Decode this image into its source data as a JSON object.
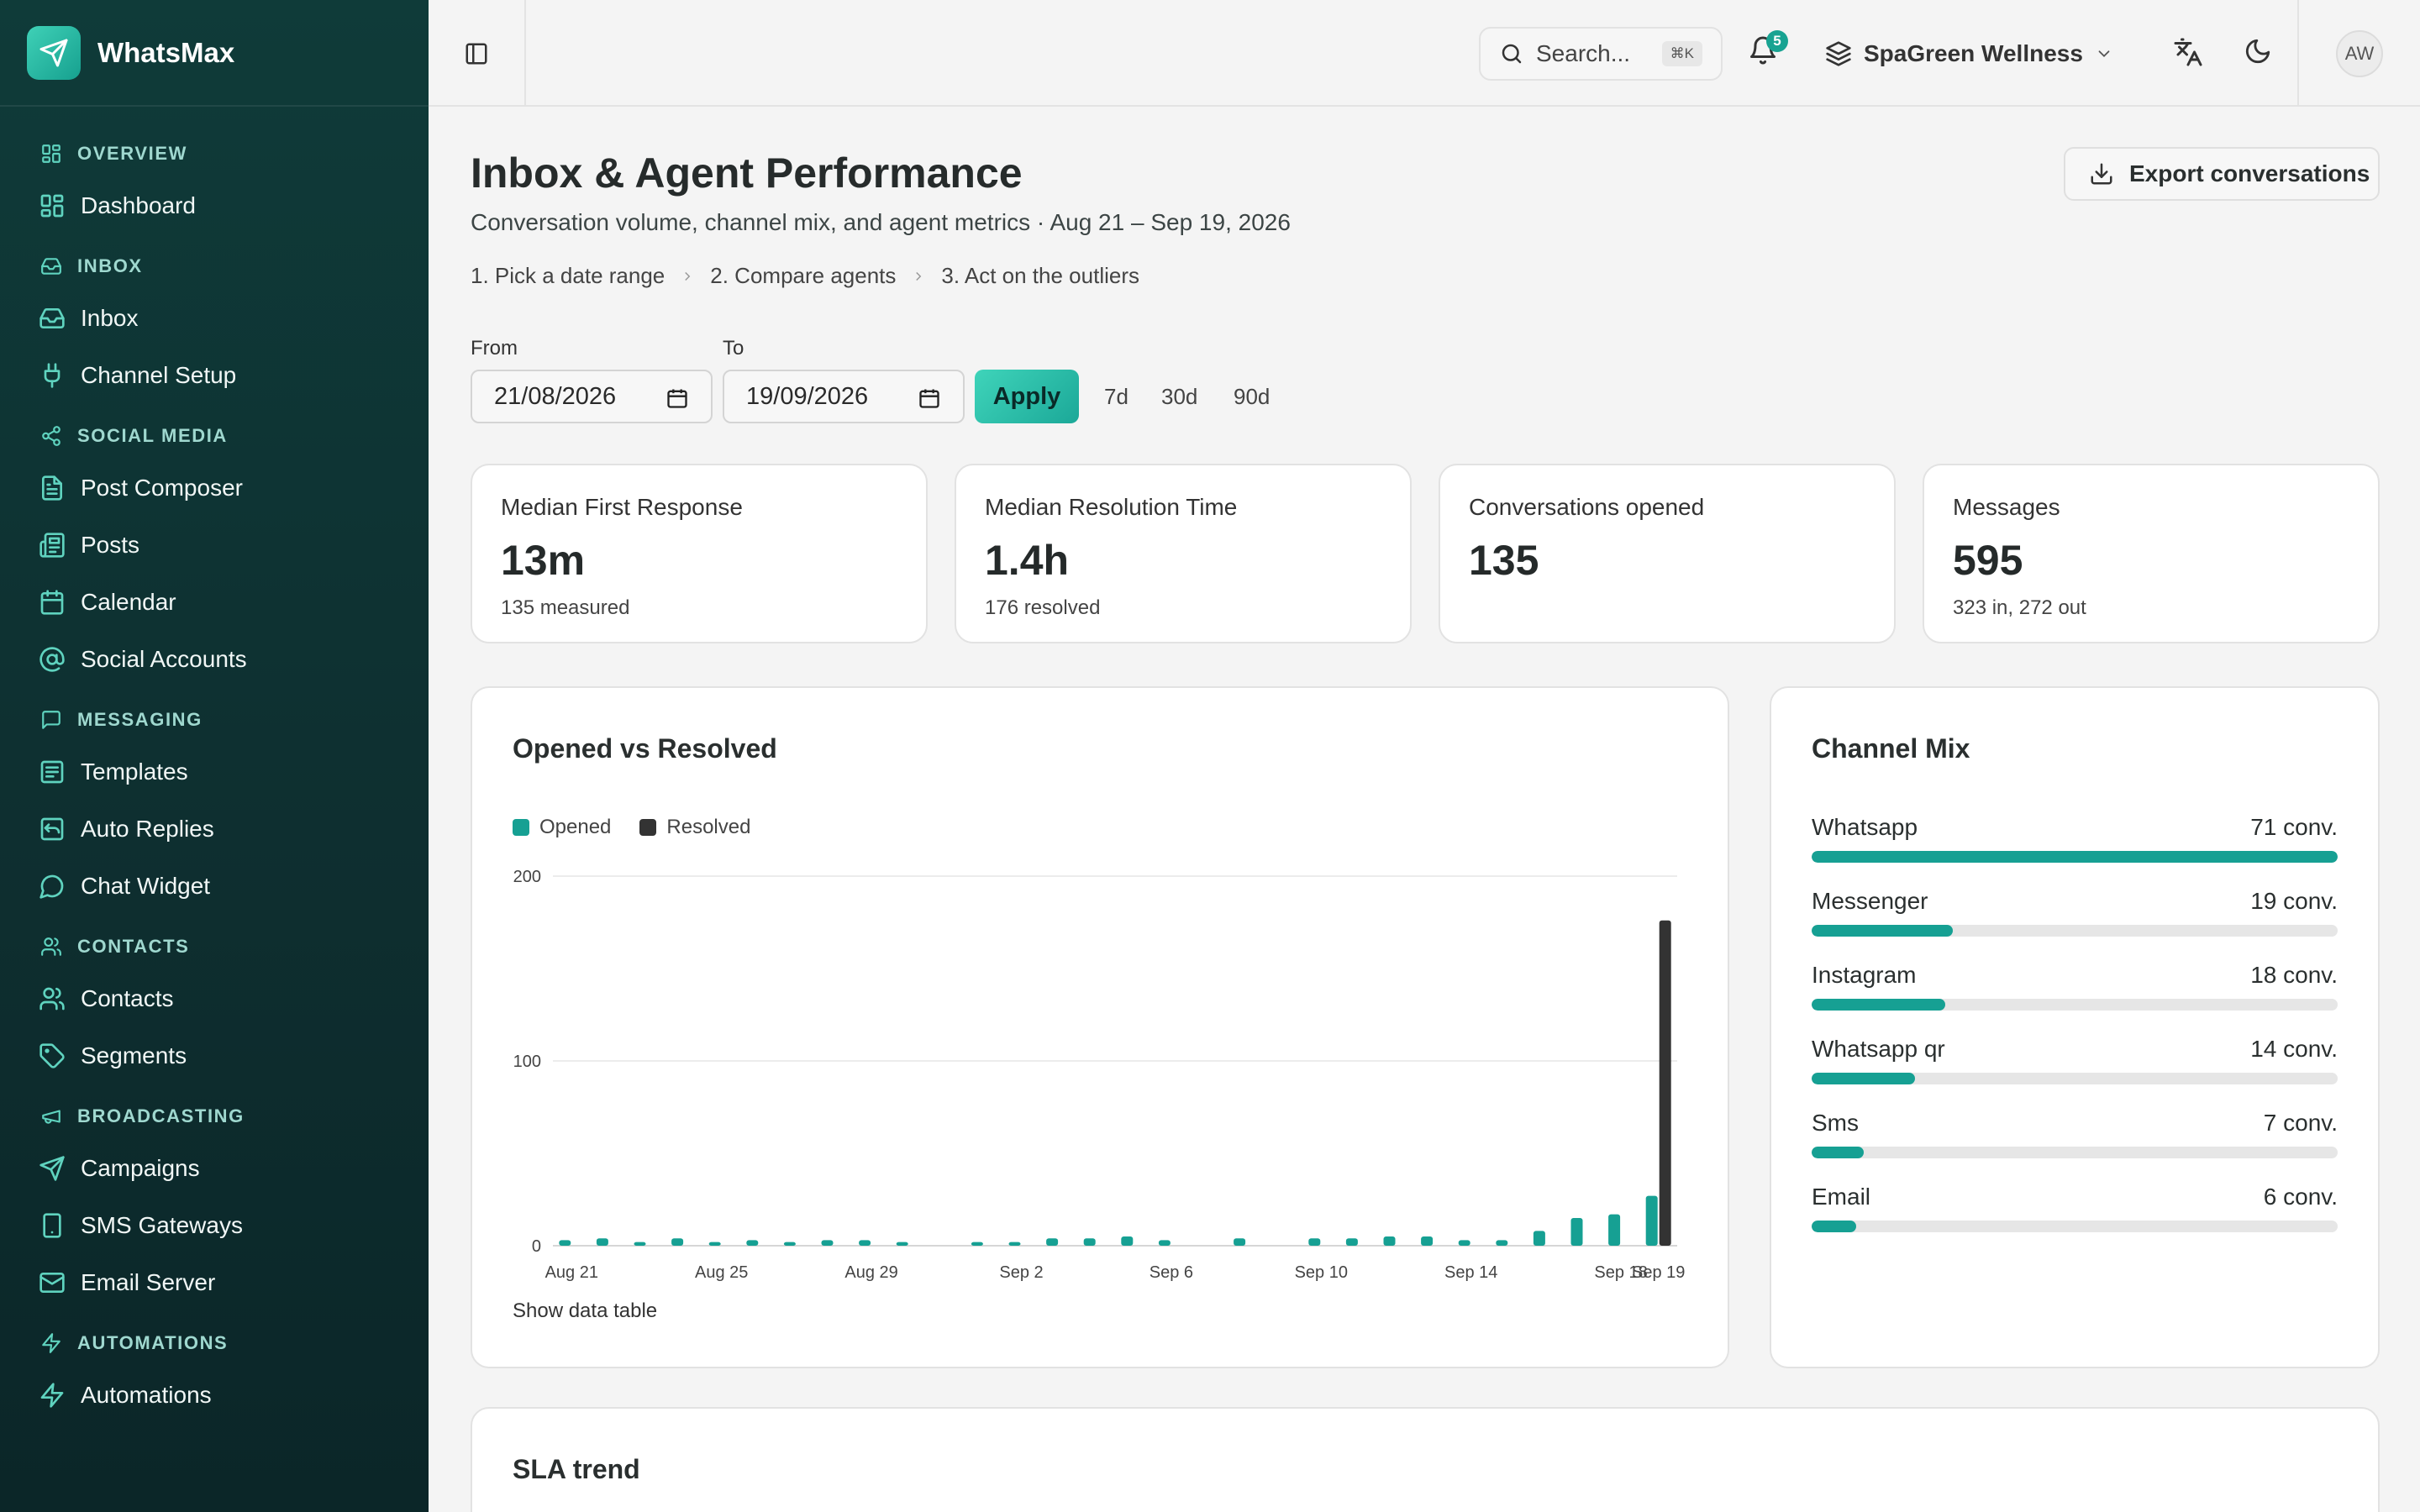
{
  "app": {
    "name": "WhatsMax"
  },
  "sidebar": {
    "sections": [
      {
        "label": "OVERVIEW",
        "icon": "dashboard-icon",
        "items": [
          {
            "label": "Dashboard",
            "icon": "dashboard-icon"
          }
        ]
      },
      {
        "label": "INBOX",
        "icon": "inbox-icon",
        "items": [
          {
            "label": "Inbox",
            "icon": "inbox-icon"
          },
          {
            "label": "Channel Setup",
            "icon": "plug-icon"
          }
        ]
      },
      {
        "label": "SOCIAL MEDIA",
        "icon": "share-icon",
        "items": [
          {
            "label": "Post Composer",
            "icon": "file-text-icon"
          },
          {
            "label": "Posts",
            "icon": "newspaper-icon"
          },
          {
            "label": "Calendar",
            "icon": "calendar-icon"
          },
          {
            "label": "Social Accounts",
            "icon": "at-sign-icon"
          }
        ]
      },
      {
        "label": "MESSAGING",
        "icon": "message-square-icon",
        "items": [
          {
            "label": "Templates",
            "icon": "template-icon"
          },
          {
            "label": "Auto Replies",
            "icon": "reply-icon"
          },
          {
            "label": "Chat Widget",
            "icon": "chat-bubble-icon"
          }
        ]
      },
      {
        "label": "CONTACTS",
        "icon": "users-icon",
        "items": [
          {
            "label": "Contacts",
            "icon": "users-icon"
          },
          {
            "label": "Segments",
            "icon": "tag-icon"
          }
        ]
      },
      {
        "label": "BROADCASTING",
        "icon": "megaphone-icon",
        "items": [
          {
            "label": "Campaigns",
            "icon": "send-icon"
          },
          {
            "label": "SMS Gateways",
            "icon": "phone-icon"
          },
          {
            "label": "Email Server",
            "icon": "mail-icon"
          }
        ]
      },
      {
        "label": "AUTOMATIONS",
        "icon": "zap-icon",
        "items": [
          {
            "label": "Automations",
            "icon": "zap-icon"
          }
        ]
      }
    ]
  },
  "topbar": {
    "search_placeholder": "Search...",
    "search_shortcut": "⌘K",
    "notification_count": "5",
    "workspace": "SpaGreen Wellness",
    "avatar_initials": "AW"
  },
  "page": {
    "title": "Inbox & Agent Performance",
    "subtitle": "Conversation volume, channel mix, and agent metrics · Aug 21 – Sep 19, 2026",
    "export_label": "Export conversations",
    "steps": [
      "1.  Pick a date range",
      "2.  Compare agents",
      "3.  Act on the outliers"
    ]
  },
  "filters": {
    "from_label": "From",
    "from_value": "21/08/2026",
    "to_label": "To",
    "to_value": "19/09/2026",
    "apply_label": "Apply",
    "ranges": [
      "7d",
      "30d",
      "90d"
    ]
  },
  "kpis": [
    {
      "label": "Median First Response",
      "value": "13m",
      "sub": "135 measured"
    },
    {
      "label": "Median Resolution Time",
      "value": "1.4h",
      "sub": "176 resolved"
    },
    {
      "label": "Conversations opened",
      "value": "135",
      "sub": ""
    },
    {
      "label": "Messages",
      "value": "595",
      "sub": "323 in, 272 out"
    }
  ],
  "opened_vs_resolved": {
    "title": "Opened vs Resolved",
    "show_table_label": "Show data table"
  },
  "channel_mix": {
    "title": "Channel Mix",
    "rows": [
      {
        "name": "Whatsapp",
        "value": 71,
        "label": "71 conv."
      },
      {
        "name": "Messenger",
        "value": 19,
        "label": "19 conv."
      },
      {
        "name": "Instagram",
        "value": 18,
        "label": "18 conv."
      },
      {
        "name": "Whatsapp qr",
        "value": 14,
        "label": "14 conv."
      },
      {
        "name": "Sms",
        "value": 7,
        "label": "7 conv."
      },
      {
        "name": "Email",
        "value": 6,
        "label": "6 conv."
      }
    ]
  },
  "sla": {
    "title": "SLA trend"
  },
  "colors": {
    "accent": "#16a093",
    "resolved": "#333333",
    "sidebar": "#0f3b39"
  },
  "chart_data": {
    "type": "bar",
    "title": "Opened vs Resolved",
    "x": [
      "Aug 21",
      "Aug 22",
      "Aug 23",
      "Aug 24",
      "Aug 25",
      "Aug 26",
      "Aug 27",
      "Aug 28",
      "Aug 29",
      "Aug 30",
      "Aug 31",
      "Sep 1",
      "Sep 2",
      "Sep 3",
      "Sep 4",
      "Sep 5",
      "Sep 6",
      "Sep 7",
      "Sep 8",
      "Sep 9",
      "Sep 10",
      "Sep 11",
      "Sep 12",
      "Sep 13",
      "Sep 14",
      "Sep 15",
      "Sep 16",
      "Sep 17",
      "Sep 18",
      "Sep 19"
    ],
    "tick_labels": [
      "Aug 21",
      "Aug 25",
      "Aug 29",
      "Sep 2",
      "Sep 6",
      "Sep 10",
      "Sep 14",
      "Sep 18",
      "Sep 19"
    ],
    "series": [
      {
        "name": "Opened",
        "color": "#16a093",
        "values": [
          3,
          4,
          2,
          4,
          2,
          3,
          2,
          3,
          3,
          2,
          0,
          2,
          2,
          4,
          4,
          5,
          3,
          0,
          4,
          0,
          4,
          4,
          5,
          5,
          3,
          3,
          8,
          15,
          17,
          27
        ]
      },
      {
        "name": "Resolved",
        "color": "#333333",
        "values": [
          0,
          0,
          0,
          0,
          0,
          0,
          0,
          0,
          0,
          0,
          0,
          0,
          0,
          0,
          0,
          0,
          0,
          0,
          0,
          0,
          0,
          0,
          0,
          0,
          0,
          0,
          0,
          0,
          0,
          176
        ]
      }
    ],
    "ylim": [
      0,
      200
    ],
    "yticks": [
      0,
      100,
      200
    ],
    "legend": "top-left",
    "grid": true
  }
}
